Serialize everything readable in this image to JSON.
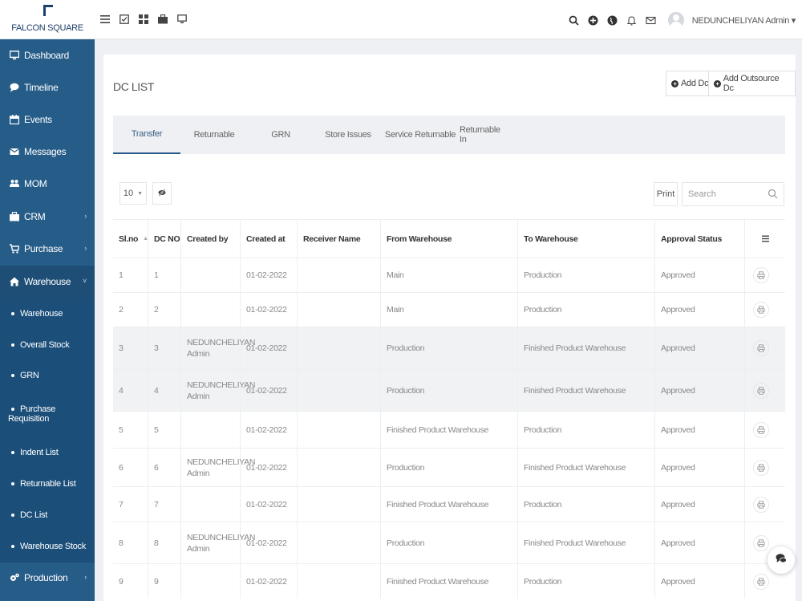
{
  "brand": {
    "name": "FALCON SQUARE"
  },
  "topbar": {
    "left_icons": [
      "list-icon",
      "checklist-icon",
      "grid-icon",
      "briefcase-icon",
      "monitor-icon"
    ],
    "right_icons": [
      "search-icon",
      "plus-circle-icon",
      "globe-icon",
      "bell-icon",
      "mail-icon"
    ],
    "user": "NEDUNCHELIYAN Admin ▾"
  },
  "sidebar": {
    "items": [
      {
        "label": "Dashboard",
        "icon": "monitor-icon"
      },
      {
        "label": "Timeline",
        "icon": "chat-icon"
      },
      {
        "label": "Events",
        "icon": "calendar-icon"
      },
      {
        "label": "Messages",
        "icon": "mail-icon"
      },
      {
        "label": "MOM",
        "icon": "users-icon"
      },
      {
        "label": "CRM",
        "icon": "briefcase-icon",
        "chevron": "›"
      },
      {
        "label": "Purchase",
        "icon": "cart-icon",
        "chevron": "›"
      },
      {
        "label": "Warehouse",
        "icon": "home-icon",
        "chevron": "˅"
      }
    ],
    "sub_items": [
      "Warehouse",
      "Overall Stock",
      "GRN",
      "Purchase",
      "Requisition",
      "Indent List",
      "Returnable List",
      "DC List",
      "Warehouse Stock"
    ],
    "bottom": {
      "label": "Production",
      "icon": "cogs-icon",
      "chevron": "›"
    }
  },
  "page": {
    "title": "DC LIST",
    "add_dc": "Add Dc",
    "add_outsource": "Add Outsource Dc"
  },
  "tabs": [
    "Transfer",
    "Returnable",
    "GRN",
    "Store Issues",
    "Service Returnable",
    "Returnable In"
  ],
  "controls": {
    "page_length": "10",
    "print": "Print",
    "search_placeholder": "Search"
  },
  "table": {
    "headers": [
      "Sl.no",
      "DC NO",
      "Created by",
      "Created at",
      "Receiver Name",
      "From Warehouse",
      "To Warehouse",
      "Approval Status"
    ],
    "rows": [
      [
        "1",
        "1",
        "",
        "01-02-2022",
        "",
        "Main",
        "Production",
        "Approved"
      ],
      [
        "2",
        "2",
        "",
        "01-02-2022",
        "",
        "Main",
        "Production",
        "Approved"
      ],
      [
        "3",
        "3",
        "NEDUNCHELIYAN Admin",
        "01-02-2022",
        "",
        "Production",
        "Finished Product Warehouse",
        "Approved"
      ],
      [
        "4",
        "4",
        "NEDUNCHELIYAN Admin",
        "01-02-2022",
        "",
        "Production",
        "Finished Product Warehouse",
        "Approved"
      ],
      [
        "5",
        "5",
        "",
        "01-02-2022",
        "",
        "Finished Product Warehouse",
        "Production",
        "Approved"
      ],
      [
        "6",
        "6",
        "NEDUNCHELIYAN Admin",
        "01-02-2022",
        "",
        "Production",
        "Finished Product Warehouse",
        "Approved"
      ],
      [
        "7",
        "7",
        "",
        "01-02-2022",
        "",
        "Finished Product Warehouse",
        "Production",
        "Approved"
      ],
      [
        "8",
        "8",
        "NEDUNCHELIYAN Admin",
        "01-02-2022",
        "",
        "Production",
        "Finished Product Warehouse",
        "Approved"
      ],
      [
        "9",
        "9",
        "",
        "01-02-2022",
        "",
        "Finished Product Warehouse",
        "Production",
        "Approved"
      ]
    ]
  }
}
